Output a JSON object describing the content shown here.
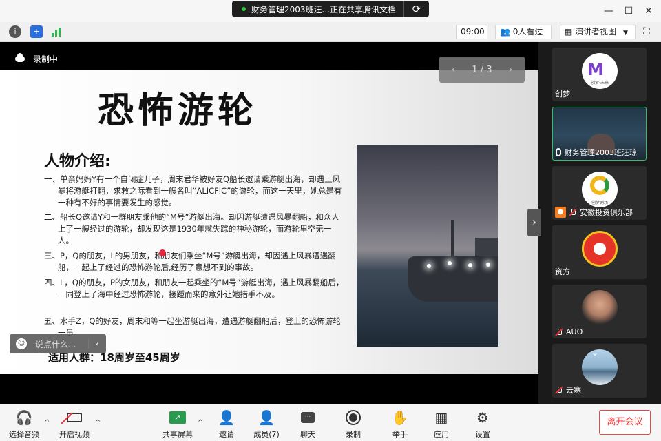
{
  "titlebar": {
    "share_text": "财务管理2003班汪...正在共享腾讯文档",
    "status_color": "#2ecc40"
  },
  "infobar": {
    "time": "09:00",
    "viewers": "0人看过",
    "view_mode": "演讲者视图"
  },
  "recording": {
    "label": "录制中"
  },
  "pager": {
    "label": "1 / 3"
  },
  "slide": {
    "title": "恐怖游轮",
    "subtitle": "人物介绍:",
    "paragraphs": [
      "一、单亲妈妈Y有一个自闭症儿子，周末君华被好友Q船长邀请乘游艇出海，却遇上风暴将游艇打翻，求救之际看到一艘名叫“ALICFIC”的游轮，而这一天里，她总是有一种有不好的事情要发生的感觉。",
      "二、船长Q邀请Y和一群朋友乘他的“M号”游艇出海。却因游艇遭遇风暴翻船，和众人上了一艘经过的游轮，却发现这是1930年就失踪的神秘游轮，而游轮里空无一人。",
      "三、P，Q的朋友，L的男朋友，和朋友们乘坐“M号”游艇出海，却因遇上风暴遭遇翻船，一起上了经过的恐怖游轮后,经历了意想不到的事故。",
      "四、L，Q的朋友，P的女朋友，和朋友一起乘坐的“M号”游艇出海，遇上风暴翻船后，一同登上了海中经过恐怖游轮，接踵而来的意外让她措手不及。",
      "五、水手Z，Q的好友，周末和等一起坐游艇出海，遭遇游艇翻船后，登上的恐怖游轮一员。"
    ],
    "target": "适用人群：18周岁至45周岁"
  },
  "chat": {
    "placeholder": "说点什么..."
  },
  "participants": [
    {
      "name": "创梦",
      "logo_text": "创梦·未来"
    },
    {
      "name": "财务管理2003班汪琼"
    },
    {
      "name": "安徽投资俱乐部",
      "logo_text": "创梦剧场"
    },
    {
      "name": "资方"
    },
    {
      "name": "AUO"
    },
    {
      "name": "云寒"
    }
  ],
  "toolbar": {
    "audio": "选择音频",
    "video": "开启视频",
    "share": "共享屏幕",
    "invite": "邀请",
    "members": "成员(7)",
    "chat": "聊天",
    "record": "录制",
    "hand": "举手",
    "apps": "应用",
    "settings": "设置",
    "leave": "离开会议"
  }
}
